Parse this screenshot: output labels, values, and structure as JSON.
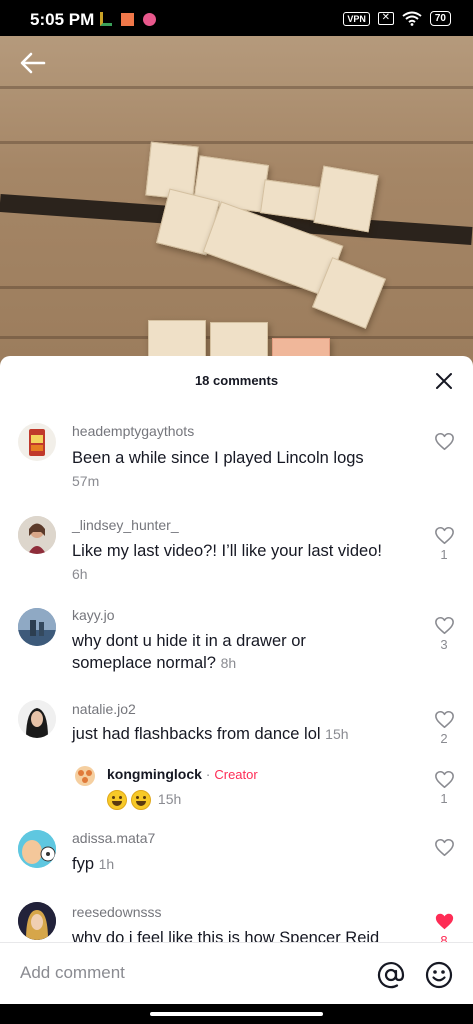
{
  "status_bar": {
    "time": "5:05 PM",
    "vpn": "VPN",
    "sim": "✕",
    "battery": "70"
  },
  "header": {
    "comment_count": "18 comments"
  },
  "comments": [
    {
      "username": "heademptygaythots",
      "text": "Been a while since I played Lincoln logs",
      "time": "57m",
      "likes": ""
    },
    {
      "username": "_lindsey_hunter_",
      "text": "Like my last video?! I’ll like your last video!",
      "time": "6h",
      "likes": "1"
    },
    {
      "username": "kayy.jo",
      "text": "why dont u hide it in a drawer or someplace normal?",
      "time": "8h",
      "likes": "3"
    },
    {
      "username": "natalie.jo2",
      "text": "just had flashbacks from dance lol",
      "time": "15h",
      "likes": "2"
    },
    {
      "username": "adissa.mata7",
      "text": "fyp",
      "time": "1h",
      "likes": ""
    },
    {
      "username": "reesedownsss",
      "text": "why do i feel like this is how Spencer Reid",
      "time": "",
      "likes": "8"
    }
  ],
  "reply": {
    "username": "kongminglock",
    "separator": "·",
    "tag": "Creator",
    "time": "15h",
    "likes": "1"
  },
  "input": {
    "placeholder": "Add comment"
  },
  "colors": {
    "accent": "#fe2c55",
    "text": "#161823",
    "secondary": "#8a8b91"
  },
  "icons": [
    "back-arrow-icon",
    "close-icon",
    "heart-icon",
    "at-icon",
    "emoji-icon"
  ]
}
